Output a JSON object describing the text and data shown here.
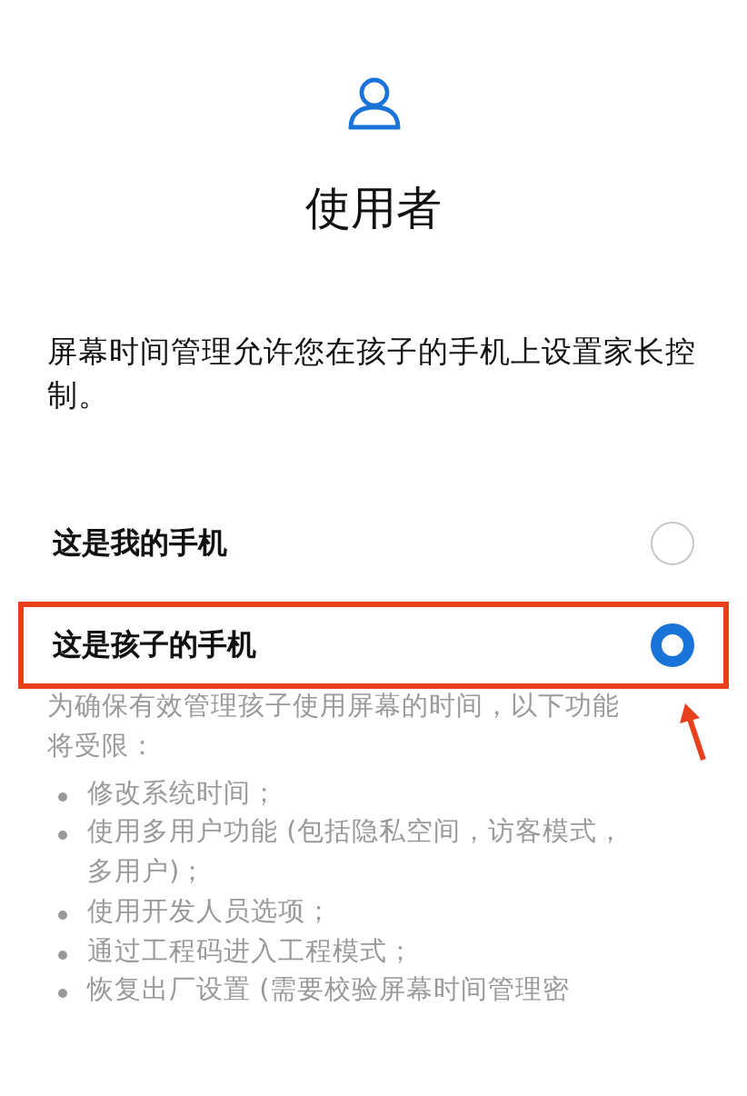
{
  "title": "使用者",
  "description": "屏幕时间管理允许您在孩子的手机上设置家长控制。",
  "options": [
    {
      "label": "这是我的手机",
      "selected": false,
      "highlighted": false
    },
    {
      "label": "这是孩子的手机",
      "selected": true,
      "highlighted": true
    }
  ],
  "restriction_note": "为确保有效管理孩子使用屏幕的时间，以下功能将受限：",
  "restrictions": [
    "修改系统时间；",
    "使用多用户功能 (包括隐私空间，访客模式，多用户)；",
    "使用开发人员选项；",
    "通过工程码进入工程模式；",
    "恢复出厂设置 (需要校验屏幕时间管理密"
  ]
}
